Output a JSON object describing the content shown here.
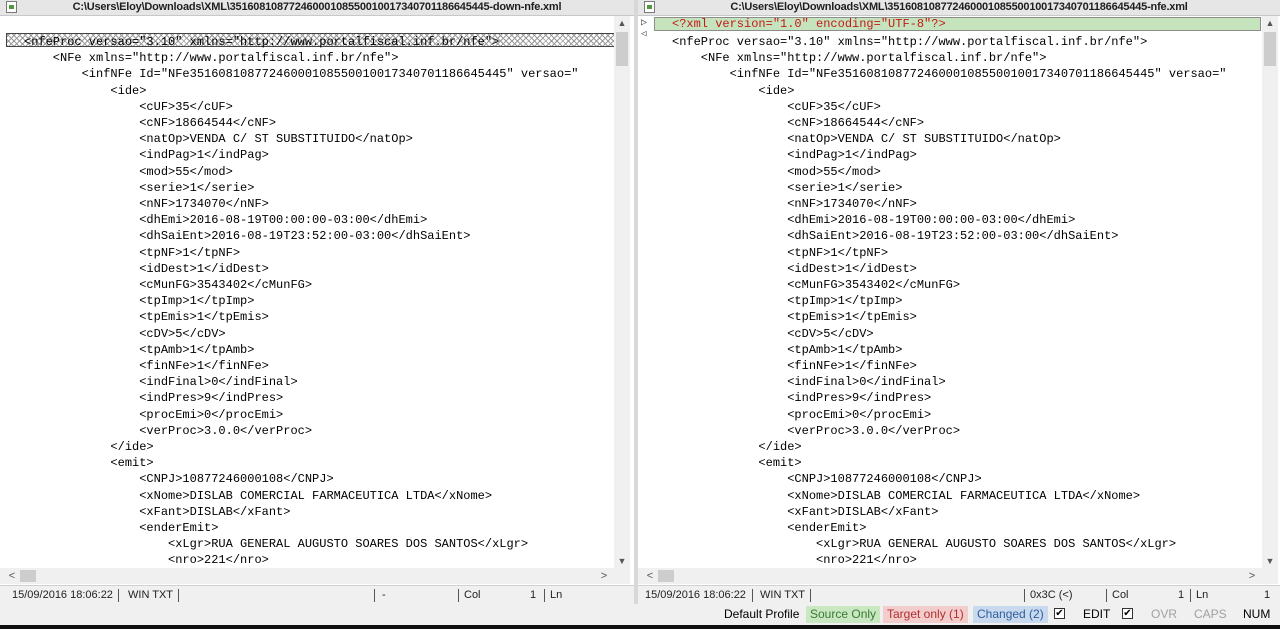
{
  "left": {
    "title": "C:\\Users\\Eloy\\Downloads\\XML\\35160810877246000108550010017340701186645445-down-nfe.xml",
    "lines": [
      "<nfeProc versao=\"3.10\" xmlns=\"http://www.portalfiscal.inf.br/nfe\">",
      "    <NFe xmlns=\"http://www.portalfiscal.inf.br/nfe\">",
      "        <infNFe Id=\"NFe35160810877246000108550010017340701186645445\" versao=\"",
      "            <ide>",
      "                <cUF>35</cUF>",
      "                <cNF>18664544</cNF>",
      "                <natOp>VENDA C/ ST SUBSTITUIDO</natOp>",
      "                <indPag>1</indPag>",
      "                <mod>55</mod>",
      "                <serie>1</serie>",
      "                <nNF>1734070</nNF>",
      "                <dhEmi>2016-08-19T00:00:00-03:00</dhEmi>",
      "                <dhSaiEnt>2016-08-19T23:52:00-03:00</dhSaiEnt>",
      "                <tpNF>1</tpNF>",
      "                <idDest>1</idDest>",
      "                <cMunFG>3543402</cMunFG>",
      "                <tpImp>1</tpImp>",
      "                <tpEmis>1</tpEmis>",
      "                <cDV>5</cDV>",
      "                <tpAmb>1</tpAmb>",
      "                <finNFe>1</finNFe>",
      "                <indFinal>0</indFinal>",
      "                <indPres>9</indPres>",
      "                <procEmi>0</procEmi>",
      "                <verProc>3.0.0</verProc>",
      "            </ide>",
      "            <emit>",
      "                <CNPJ>10877246000108</CNPJ>",
      "                <xNome>DISLAB COMERCIAL FARMACEUTICA LTDA</xNome>",
      "                <xFant>DISLAB</xFant>",
      "                <enderEmit>",
      "                    <xLgr>RUA GENERAL AUGUSTO SOARES DOS SANTOS</xLgr>",
      "                    <nro>221</nro>"
    ],
    "status": {
      "datetime": "15/09/2016 18:06:22",
      "mode": "WIN TXT",
      "char": "-",
      "col_label": "Col",
      "col_value": "1",
      "ln_label": "Ln"
    }
  },
  "right": {
    "title": "C:\\Users\\Eloy\\Downloads\\XML\\35160810877246000108550010017340701186645445-nfe.xml",
    "xml_decl": "<?xml version=\"1.0\" encoding=\"UTF-8\"?>",
    "lines": [
      "<nfeProc versao=\"3.10\" xmlns=\"http://www.portalfiscal.inf.br/nfe\">",
      "    <NFe xmlns=\"http://www.portalfiscal.inf.br/nfe\">",
      "        <infNFe Id=\"NFe35160810877246000108550010017340701186645445\" versao=\"",
      "            <ide>",
      "                <cUF>35</cUF>",
      "                <cNF>18664544</cNF>",
      "                <natOp>VENDA C/ ST SUBSTITUIDO</natOp>",
      "                <indPag>1</indPag>",
      "                <mod>55</mod>",
      "                <serie>1</serie>",
      "                <nNF>1734070</nNF>",
      "                <dhEmi>2016-08-19T00:00:00-03:00</dhEmi>",
      "                <dhSaiEnt>2016-08-19T23:52:00-03:00</dhSaiEnt>",
      "                <tpNF>1</tpNF>",
      "                <idDest>1</idDest>",
      "                <cMunFG>3543402</cMunFG>",
      "                <tpImp>1</tpImp>",
      "                <tpEmis>1</tpEmis>",
      "                <cDV>5</cDV>",
      "                <tpAmb>1</tpAmb>",
      "                <finNFe>1</finNFe>",
      "                <indFinal>0</indFinal>",
      "                <indPres>9</indPres>",
      "                <procEmi>0</procEmi>",
      "                <verProc>3.0.0</verProc>",
      "            </ide>",
      "            <emit>",
      "                <CNPJ>10877246000108</CNPJ>",
      "                <xNome>DISLAB COMERCIAL FARMACEUTICA LTDA</xNome>",
      "                <xFant>DISLAB</xFant>",
      "                <enderEmit>",
      "                    <xLgr>RUA GENERAL AUGUSTO SOARES DOS SANTOS</xLgr>",
      "                    <nro>221</nro>"
    ],
    "status": {
      "datetime": "15/09/2016 18:06:22",
      "mode": "WIN TXT",
      "char": "0x3C (<)",
      "col_label": "Col",
      "col_value": "1",
      "ln_label": "Ln",
      "ln_value": "1"
    }
  },
  "bottom": {
    "profile": "Default Profile",
    "source_only": "Source Only",
    "target_only": "Target only (1)",
    "changed": "Changed (2)",
    "check": "✔",
    "edit": "EDIT",
    "ovr": "OVR",
    "caps": "CAPS",
    "num": "NUM"
  },
  "colors": {
    "source_only": "#3a7a33",
    "target_only": "#b13030",
    "changed": "#2f5f9e",
    "xml_decl": "#c41a1a",
    "xml_decl_bg": "#c5e3bd"
  }
}
